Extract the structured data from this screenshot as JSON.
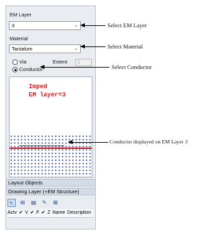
{
  "em_layer": {
    "label": "EM Layer",
    "value": "3"
  },
  "material": {
    "label": "Material",
    "value": "Tantalum"
  },
  "options": {
    "via_label": "Via",
    "extent_label": "Extent",
    "extent_value": "1",
    "conductor_label": "Conductor",
    "selected": "Conductor"
  },
  "canvas": {
    "line1": "Imped",
    "line2": "EM layer=3"
  },
  "layout_objects": {
    "title": "Layout Objects"
  },
  "drawing_layer": {
    "title": "Drawing Layer (+EM Structure)"
  },
  "columns": [
    "Actv",
    "V",
    "F",
    "Z",
    "Name",
    "Description"
  ],
  "annotations": {
    "select_em_layer": "Select EM Layer",
    "select_material": "Select Material",
    "select_conductor": "Select Conductor",
    "conductor_displayed": "Conductor displayed on EM Layer 3"
  },
  "icons": [
    "select-arrow-icon",
    "grid-icon",
    "layers-icon",
    "edit-icon",
    "delete-icon"
  ]
}
